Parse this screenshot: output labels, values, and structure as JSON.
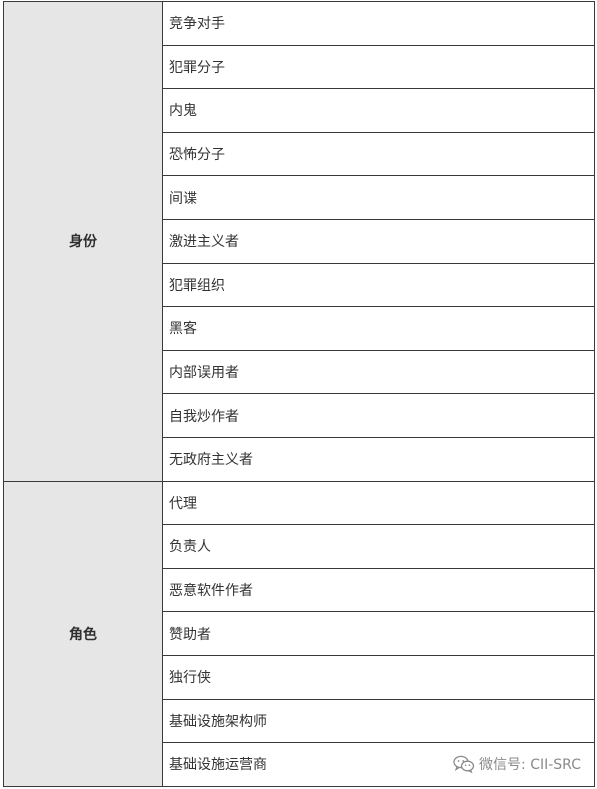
{
  "groups": [
    {
      "category": "身份",
      "items": [
        "竞争对手",
        "犯罪分子",
        "内鬼",
        "恐怖分子",
        "间谍",
        "激进主义者",
        "犯罪组织",
        "黑客",
        "内部误用者",
        "自我炒作者",
        "无政府主义者"
      ]
    },
    {
      "category": "角色",
      "items": [
        "代理",
        "负责人",
        "恶意软件作者",
        "赞助者",
        "独行侠",
        "基础设施架构师",
        "基础设施运营商"
      ]
    }
  ],
  "watermark": {
    "icon": "wechat-icon",
    "text": "微信号: CII-SRC"
  }
}
